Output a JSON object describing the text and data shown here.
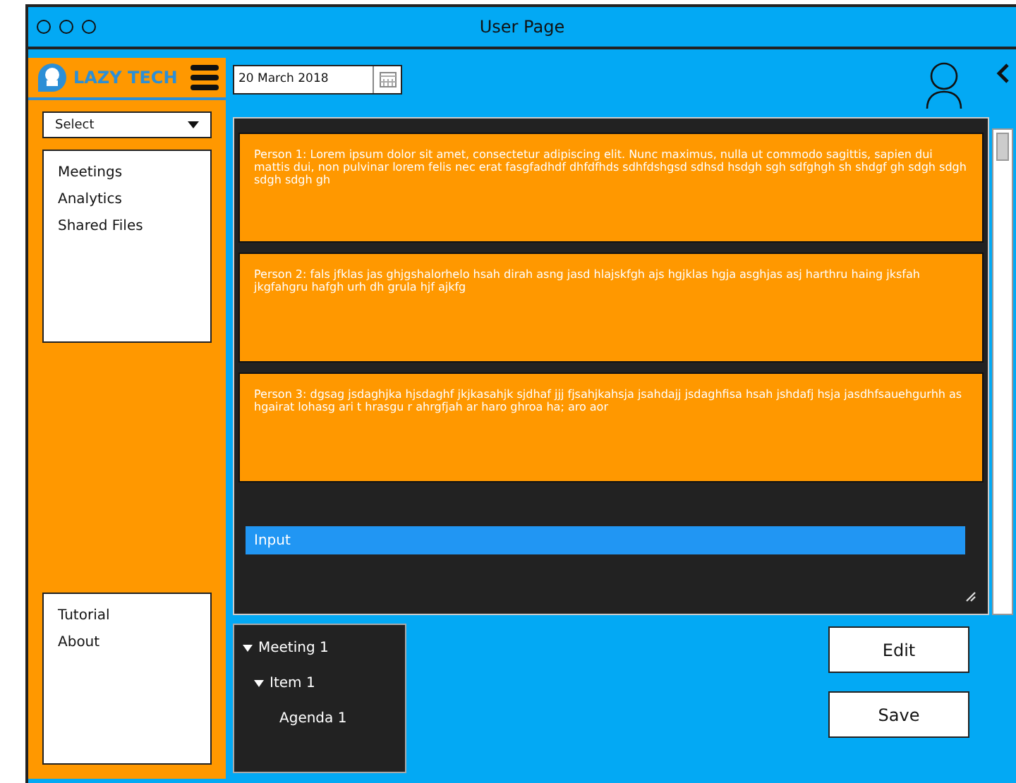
{
  "window": {
    "title": "User Page"
  },
  "sidebar": {
    "logo": "LAZY TECH",
    "select": {
      "value": "Select"
    },
    "nav_items": [
      "Meetings",
      "Analytics",
      "Shared Files"
    ],
    "bottom_items": [
      "Tutorial",
      "About"
    ]
  },
  "date_field": {
    "value": "20 March 2018"
  },
  "messages": [
    {
      "text": "Person 1: Lorem ipsum dolor sit amet, consectetur adipiscing elit. Nunc maximus, nulla ut commodo sagittis, sapien dui mattis dui, non pulvinar lorem felis nec erat fasgfadhdf dhfdfhds sdhfdshgsd sdhsd hsdgh sgh sdfghgh sh shdgf gh sdgh sdgh sdgh sdgh gh"
    },
    {
      "text": "Person 2: fals jfklas jas ghjgshalorhelo hsah dirah asng jasd hlajskfgh ajs hgjklas hgja asghjas asj harthru haing jksfah jkgfahgru hafgh urh dh grula hjf ajkfg"
    },
    {
      "text": "Person 3: dgsag jsdaghjka hjsdaghf jkjkasahjk sjdhaf jjj fjsahjkahsja jsahdajj jsdaghfisa hsah jshdafj hsja jasdhfsauehgurhh as hgairat lohasg ari t hrasgu r ahrgfjah ar haro ghroa ha; aro aor"
    }
  ],
  "input": {
    "placeholder": "Input"
  },
  "tree": [
    {
      "label": "Meeting 1",
      "expanded": true,
      "children": [
        {
          "label": "Item 1",
          "expanded": true,
          "children": [
            {
              "label": "Agenda 1"
            }
          ]
        }
      ]
    }
  ],
  "buttons": [
    "Edit",
    "Save"
  ]
}
